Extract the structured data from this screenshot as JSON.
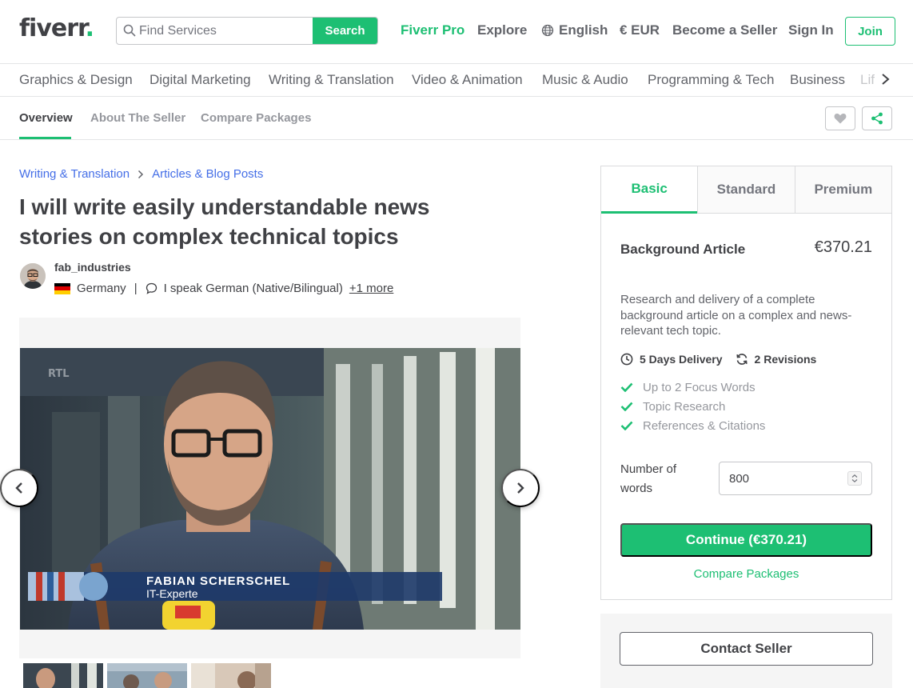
{
  "header": {
    "logo": "fiverr",
    "logo_dot": ".",
    "search_placeholder": "Find Services",
    "search_button": "Search",
    "nav": {
      "pro": "Fiverr Pro",
      "explore": "Explore",
      "language": "English",
      "currency": "€ EUR",
      "become_seller": "Become a Seller",
      "sign_in": "Sign In",
      "join": "Join"
    }
  },
  "categories": [
    "Graphics & Design",
    "Digital Marketing",
    "Writing & Translation",
    "Video & Animation",
    "Music & Audio",
    "Programming & Tech",
    "Business",
    "Lif"
  ],
  "subnav": {
    "tabs": [
      "Overview",
      "About The Seller",
      "Compare Packages"
    ],
    "active": "Overview"
  },
  "breadcrumb": [
    "Writing & Translation",
    "Articles & Blog Posts"
  ],
  "gig": {
    "title": "I will write easily understandable news stories on complex technical topics"
  },
  "seller": {
    "username": "fab_industries",
    "country": "Germany",
    "language": "I speak German (Native/Bilingual)",
    "more": "+1 more"
  },
  "video_overlay": {
    "channel": "RTL",
    "name": "FABIAN SCHERSCHEL",
    "role": "IT-Experte"
  },
  "package": {
    "tabs": [
      "Basic",
      "Standard",
      "Premium"
    ],
    "active_tab": "Basic",
    "name": "Background Article",
    "price": "€370.21",
    "description": "Research and delivery of a complete background article on a complex and news-relevant tech topic.",
    "delivery": "5 Days Delivery",
    "revisions": "2 Revisions",
    "features": [
      "Up to 2 Focus Words",
      "Topic Research",
      "References & Citations"
    ],
    "words_label": "Number of words",
    "words_value": "800",
    "continue_button": "Continue (€370.21)",
    "compare_link": "Compare Packages"
  },
  "contact": {
    "button": "Contact Seller"
  },
  "colors": {
    "brand_green": "#1dbf73",
    "link_blue": "#446ee7",
    "text_dark": "#404145"
  }
}
